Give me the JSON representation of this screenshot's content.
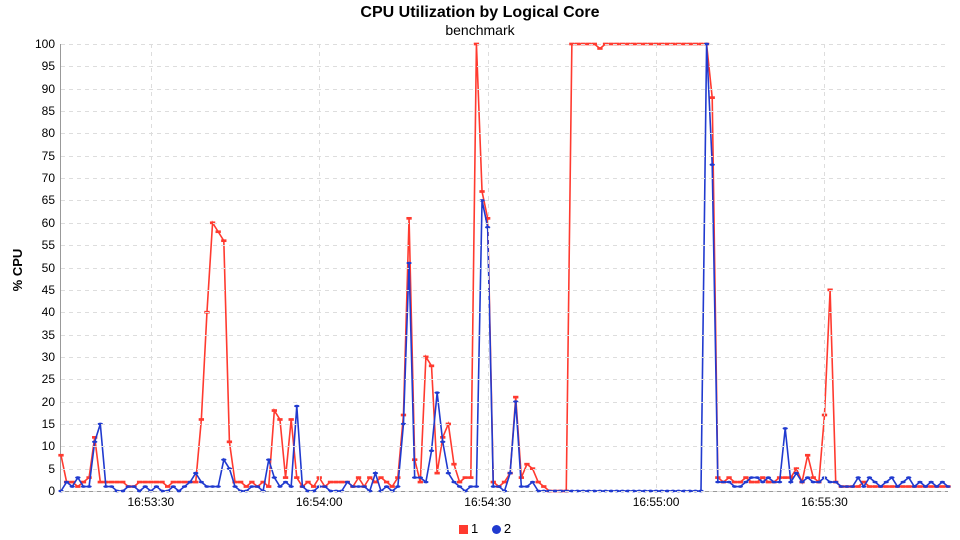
{
  "chart_data": {
    "type": "line",
    "title": "CPU Utilization by Logical Core",
    "subtitle": "benchmark",
    "xlabel": "",
    "ylabel": "% CPU",
    "ylim": [
      0,
      100
    ],
    "yticks": [
      0,
      5,
      10,
      15,
      20,
      25,
      30,
      35,
      40,
      45,
      50,
      55,
      60,
      65,
      70,
      75,
      80,
      85,
      90,
      95,
      100
    ],
    "xrange_sec": [
      60794,
      60952
    ],
    "xticks": [
      {
        "sec": 60810,
        "label": "16:53:30"
      },
      {
        "sec": 60840,
        "label": "16:54:00"
      },
      {
        "sec": 60870,
        "label": "16:54:30"
      },
      {
        "sec": 60900,
        "label": "16:55:00"
      },
      {
        "sec": 60930,
        "label": "16:55:30"
      }
    ],
    "x": [
      60794,
      60795,
      60796,
      60797,
      60798,
      60799,
      60800,
      60801,
      60802,
      60803,
      60804,
      60805,
      60806,
      60807,
      60808,
      60809,
      60810,
      60811,
      60812,
      60813,
      60814,
      60815,
      60816,
      60817,
      60818,
      60819,
      60820,
      60821,
      60822,
      60823,
      60824,
      60825,
      60826,
      60827,
      60828,
      60829,
      60830,
      60831,
      60832,
      60833,
      60834,
      60835,
      60836,
      60837,
      60838,
      60839,
      60840,
      60841,
      60842,
      60843,
      60844,
      60845,
      60846,
      60847,
      60848,
      60849,
      60850,
      60851,
      60852,
      60853,
      60854,
      60855,
      60856,
      60857,
      60858,
      60859,
      60860,
      60861,
      60862,
      60863,
      60864,
      60865,
      60866,
      60867,
      60868,
      60869,
      60870,
      60871,
      60872,
      60873,
      60874,
      60875,
      60876,
      60877,
      60878,
      60879,
      60880,
      60881,
      60882,
      60883,
      60884,
      60885,
      60886,
      60887,
      60888,
      60889,
      60890,
      60891,
      60892,
      60893,
      60894,
      60895,
      60896,
      60897,
      60898,
      60899,
      60900,
      60901,
      60902,
      60903,
      60904,
      60905,
      60906,
      60907,
      60908,
      60909,
      60910,
      60911,
      60912,
      60913,
      60914,
      60915,
      60916,
      60917,
      60918,
      60919,
      60920,
      60921,
      60922,
      60923,
      60924,
      60925,
      60926,
      60927,
      60928,
      60929,
      60930,
      60931,
      60932,
      60933,
      60934,
      60935,
      60936,
      60937,
      60938,
      60939,
      60940,
      60941,
      60942,
      60943,
      60944,
      60945,
      60946,
      60947,
      60948,
      60949,
      60950,
      60951,
      60952
    ],
    "series": [
      {
        "name": "1",
        "color": "#ff3a2f",
        "marker": "square",
        "values": [
          8,
          2,
          2,
          1,
          2,
          3,
          12,
          2,
          2,
          2,
          2,
          2,
          1,
          1,
          2,
          2,
          2,
          2,
          2,
          1,
          2,
          2,
          2,
          2,
          2,
          16,
          40,
          60,
          58,
          56,
          11,
          2,
          2,
          1,
          2,
          1,
          2,
          1,
          18,
          16,
          3,
          16,
          3,
          1,
          2,
          1,
          3,
          1,
          2,
          2,
          2,
          2,
          1,
          3,
          1,
          3,
          2,
          3,
          2,
          1,
          3,
          17,
          61,
          7,
          2,
          30,
          28,
          4,
          12,
          15,
          6,
          2,
          3,
          3,
          100,
          67,
          61,
          2,
          1,
          2,
          4,
          21,
          3,
          6,
          5,
          2,
          1,
          0,
          0,
          0,
          0,
          100,
          100,
          100,
          100,
          100,
          99,
          100,
          100,
          100,
          100,
          100,
          100,
          100,
          100,
          100,
          100,
          100,
          100,
          100,
          100,
          100,
          100,
          100,
          100,
          100,
          88,
          3,
          2,
          3,
          2,
          2,
          3,
          2,
          2,
          3,
          2,
          2,
          3,
          3,
          3,
          5,
          2,
          8,
          3,
          2,
          17,
          45,
          2,
          1,
          1,
          1,
          1,
          2,
          1,
          1,
          1,
          1,
          1,
          1,
          1,
          1,
          1,
          1,
          1,
          1,
          1,
          1,
          1
        ]
      },
      {
        "name": "2",
        "color": "#203acf",
        "marker": "circle",
        "values": [
          0,
          2,
          1,
          3,
          1,
          1,
          11,
          15,
          1,
          1,
          0,
          0,
          1,
          1,
          0,
          1,
          0,
          1,
          0,
          0,
          1,
          0,
          1,
          2,
          4,
          2,
          1,
          1,
          1,
          7,
          5,
          1,
          0,
          0,
          1,
          1,
          0,
          7,
          3,
          1,
          2,
          1,
          19,
          1,
          0,
          0,
          1,
          1,
          0,
          0,
          0,
          2,
          1,
          1,
          1,
          0,
          4,
          0,
          1,
          0,
          1,
          15,
          51,
          3,
          3,
          2,
          9,
          22,
          11,
          4,
          2,
          1,
          0,
          1,
          1,
          65,
          59,
          1,
          1,
          0,
          4,
          20,
          1,
          1,
          2,
          0,
          0,
          0,
          0,
          0,
          0,
          0,
          0,
          0,
          0,
          0,
          0,
          0,
          0,
          0,
          0,
          0,
          0,
          0,
          0,
          0,
          0,
          0,
          0,
          0,
          0,
          0,
          0,
          0,
          0,
          100,
          73,
          2,
          2,
          2,
          1,
          1,
          2,
          3,
          3,
          2,
          3,
          2,
          2,
          14,
          2,
          4,
          2,
          3,
          2,
          2,
          3,
          2,
          2,
          1,
          1,
          1,
          3,
          1,
          3,
          2,
          1,
          2,
          3,
          1,
          2,
          3,
          1,
          2,
          1,
          2,
          1,
          2,
          1
        ]
      }
    ]
  }
}
